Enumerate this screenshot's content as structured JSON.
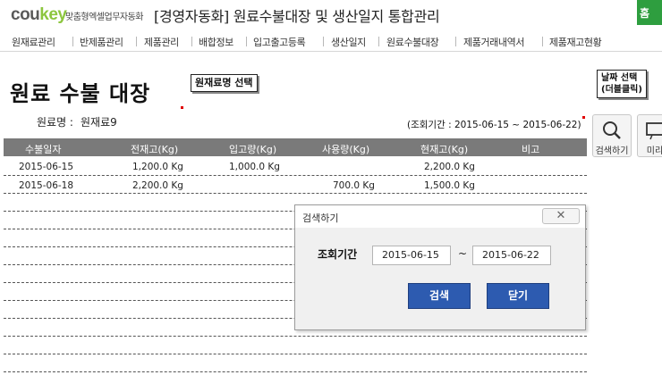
{
  "header": {
    "logo_part1": "cou",
    "logo_part2": "key",
    "logo_sub": "맞춤형엑셀업무자동화",
    "title": "[경영자동화] 원료수불대장 및 생산일지 통합관리",
    "home_label": "홈"
  },
  "nav": {
    "items": [
      "원재료관리",
      "반제품관리",
      "제품관리",
      "배합정보",
      "입고출고등록",
      "생산일지",
      "원료수불대장",
      "제품거래내역서",
      "제품재고현황"
    ]
  },
  "page": {
    "title": "원료 수불 대장",
    "material_label": "원료명 :",
    "material_value": "원재료9",
    "period_label": "(조회기간 : 2015-06-15 ~ 2015-06-22)",
    "callout_material": "원재료명 선택",
    "callout_date_line1": "날짜 선택",
    "callout_date_line2": "(더블클릭)",
    "search_btn_label": "검색하기",
    "preview_btn_label": "미리",
    "accent_red": "#e00000"
  },
  "table": {
    "headers": [
      "수불일자",
      "전재고(Kg)",
      "입고량(Kg)",
      "사용량(Kg)",
      "현재고(Kg)",
      "비고"
    ],
    "rows": [
      [
        "2015-06-15",
        "1,200.0 Kg",
        "1,000.0 Kg",
        "",
        "2,200.0 Kg",
        ""
      ],
      [
        "2015-06-18",
        "2,200.0 Kg",
        "",
        "700.0 Kg",
        "1,500.0 Kg",
        ""
      ]
    ]
  },
  "dialog": {
    "title": "검색하기",
    "close_symbol": "✕",
    "label": "조회기간",
    "start_date": "2015-06-15",
    "tilde": "~",
    "end_date": "2015-06-22",
    "search_label": "검색",
    "close_label": "닫기",
    "button_color": "#2d5bb0"
  }
}
